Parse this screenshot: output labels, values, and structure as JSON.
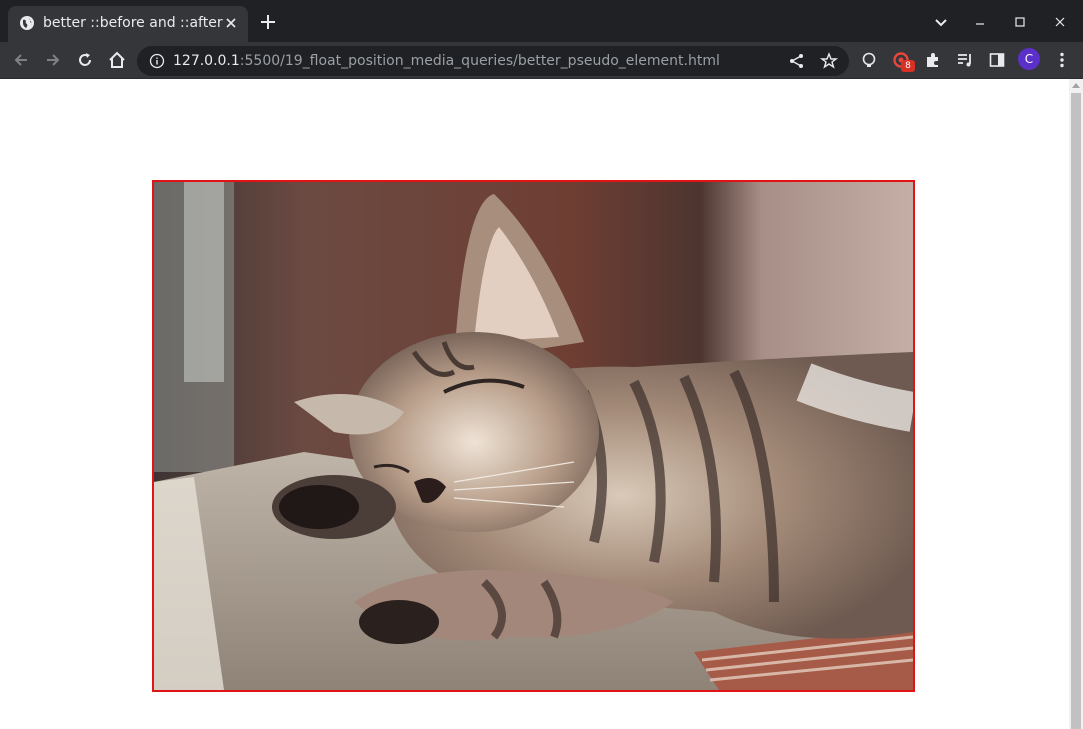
{
  "browser": {
    "tab_title": "better ::before and ::after",
    "url_host": "127.0.0.1",
    "url_rest": ":5500/19_float_position_media_queries/better_pseudo_element.html",
    "extension_badge": "8",
    "profile_initial": "C"
  },
  "page": {
    "image_description": "sleeping tabby kitten",
    "frame_color": "#e01414"
  }
}
